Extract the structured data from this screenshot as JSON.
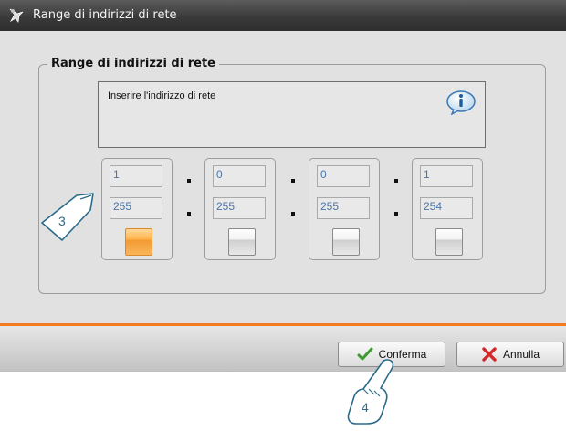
{
  "window": {
    "title": "Range di indirizzi di rete"
  },
  "group": {
    "title": "Range di indirizzi di rete"
  },
  "info": {
    "text": "Inserire l'indirizzo di rete",
    "icon": "info-icon"
  },
  "octets": [
    {
      "from": "1",
      "to": "255",
      "selected": true
    },
    {
      "from": "0",
      "to": "255",
      "selected": false
    },
    {
      "from": "0",
      "to": "255",
      "selected": false
    },
    {
      "from": "1",
      "to": "254",
      "selected": false
    }
  ],
  "buttons": {
    "confirm": {
      "label": "Conferma",
      "icon": "checkmark-icon"
    },
    "cancel": {
      "label": "Annulla",
      "icon": "x-icon"
    }
  },
  "callouts": {
    "step3": "3",
    "step4": "4"
  },
  "colors": {
    "accent": "#f47b20",
    "field_text": "#4a76a8",
    "selected_button": "#f29a32",
    "callout_text": "#2a6b8a"
  }
}
